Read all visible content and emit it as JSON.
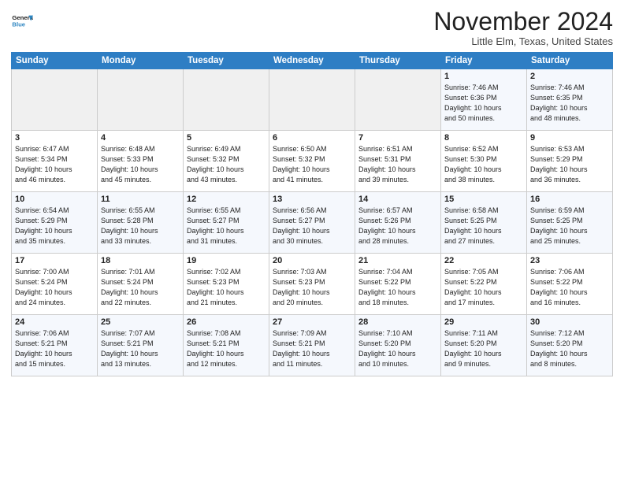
{
  "header": {
    "logo_line1": "General",
    "logo_line2": "Blue",
    "month": "November 2024",
    "location": "Little Elm, Texas, United States"
  },
  "weekdays": [
    "Sunday",
    "Monday",
    "Tuesday",
    "Wednesday",
    "Thursday",
    "Friday",
    "Saturday"
  ],
  "weeks": [
    [
      {
        "day": "",
        "info": ""
      },
      {
        "day": "",
        "info": ""
      },
      {
        "day": "",
        "info": ""
      },
      {
        "day": "",
        "info": ""
      },
      {
        "day": "",
        "info": ""
      },
      {
        "day": "1",
        "info": "Sunrise: 7:46 AM\nSunset: 6:36 PM\nDaylight: 10 hours\nand 50 minutes."
      },
      {
        "day": "2",
        "info": "Sunrise: 7:46 AM\nSunset: 6:35 PM\nDaylight: 10 hours\nand 48 minutes."
      }
    ],
    [
      {
        "day": "3",
        "info": "Sunrise: 6:47 AM\nSunset: 5:34 PM\nDaylight: 10 hours\nand 46 minutes."
      },
      {
        "day": "4",
        "info": "Sunrise: 6:48 AM\nSunset: 5:33 PM\nDaylight: 10 hours\nand 45 minutes."
      },
      {
        "day": "5",
        "info": "Sunrise: 6:49 AM\nSunset: 5:32 PM\nDaylight: 10 hours\nand 43 minutes."
      },
      {
        "day": "6",
        "info": "Sunrise: 6:50 AM\nSunset: 5:32 PM\nDaylight: 10 hours\nand 41 minutes."
      },
      {
        "day": "7",
        "info": "Sunrise: 6:51 AM\nSunset: 5:31 PM\nDaylight: 10 hours\nand 39 minutes."
      },
      {
        "day": "8",
        "info": "Sunrise: 6:52 AM\nSunset: 5:30 PM\nDaylight: 10 hours\nand 38 minutes."
      },
      {
        "day": "9",
        "info": "Sunrise: 6:53 AM\nSunset: 5:29 PM\nDaylight: 10 hours\nand 36 minutes."
      }
    ],
    [
      {
        "day": "10",
        "info": "Sunrise: 6:54 AM\nSunset: 5:29 PM\nDaylight: 10 hours\nand 35 minutes."
      },
      {
        "day": "11",
        "info": "Sunrise: 6:55 AM\nSunset: 5:28 PM\nDaylight: 10 hours\nand 33 minutes."
      },
      {
        "day": "12",
        "info": "Sunrise: 6:55 AM\nSunset: 5:27 PM\nDaylight: 10 hours\nand 31 minutes."
      },
      {
        "day": "13",
        "info": "Sunrise: 6:56 AM\nSunset: 5:27 PM\nDaylight: 10 hours\nand 30 minutes."
      },
      {
        "day": "14",
        "info": "Sunrise: 6:57 AM\nSunset: 5:26 PM\nDaylight: 10 hours\nand 28 minutes."
      },
      {
        "day": "15",
        "info": "Sunrise: 6:58 AM\nSunset: 5:25 PM\nDaylight: 10 hours\nand 27 minutes."
      },
      {
        "day": "16",
        "info": "Sunrise: 6:59 AM\nSunset: 5:25 PM\nDaylight: 10 hours\nand 25 minutes."
      }
    ],
    [
      {
        "day": "17",
        "info": "Sunrise: 7:00 AM\nSunset: 5:24 PM\nDaylight: 10 hours\nand 24 minutes."
      },
      {
        "day": "18",
        "info": "Sunrise: 7:01 AM\nSunset: 5:24 PM\nDaylight: 10 hours\nand 22 minutes."
      },
      {
        "day": "19",
        "info": "Sunrise: 7:02 AM\nSunset: 5:23 PM\nDaylight: 10 hours\nand 21 minutes."
      },
      {
        "day": "20",
        "info": "Sunrise: 7:03 AM\nSunset: 5:23 PM\nDaylight: 10 hours\nand 20 minutes."
      },
      {
        "day": "21",
        "info": "Sunrise: 7:04 AM\nSunset: 5:22 PM\nDaylight: 10 hours\nand 18 minutes."
      },
      {
        "day": "22",
        "info": "Sunrise: 7:05 AM\nSunset: 5:22 PM\nDaylight: 10 hours\nand 17 minutes."
      },
      {
        "day": "23",
        "info": "Sunrise: 7:06 AM\nSunset: 5:22 PM\nDaylight: 10 hours\nand 16 minutes."
      }
    ],
    [
      {
        "day": "24",
        "info": "Sunrise: 7:06 AM\nSunset: 5:21 PM\nDaylight: 10 hours\nand 15 minutes."
      },
      {
        "day": "25",
        "info": "Sunrise: 7:07 AM\nSunset: 5:21 PM\nDaylight: 10 hours\nand 13 minutes."
      },
      {
        "day": "26",
        "info": "Sunrise: 7:08 AM\nSunset: 5:21 PM\nDaylight: 10 hours\nand 12 minutes."
      },
      {
        "day": "27",
        "info": "Sunrise: 7:09 AM\nSunset: 5:21 PM\nDaylight: 10 hours\nand 11 minutes."
      },
      {
        "day": "28",
        "info": "Sunrise: 7:10 AM\nSunset: 5:20 PM\nDaylight: 10 hours\nand 10 minutes."
      },
      {
        "day": "29",
        "info": "Sunrise: 7:11 AM\nSunset: 5:20 PM\nDaylight: 10 hours\nand 9 minutes."
      },
      {
        "day": "30",
        "info": "Sunrise: 7:12 AM\nSunset: 5:20 PM\nDaylight: 10 hours\nand 8 minutes."
      }
    ]
  ]
}
